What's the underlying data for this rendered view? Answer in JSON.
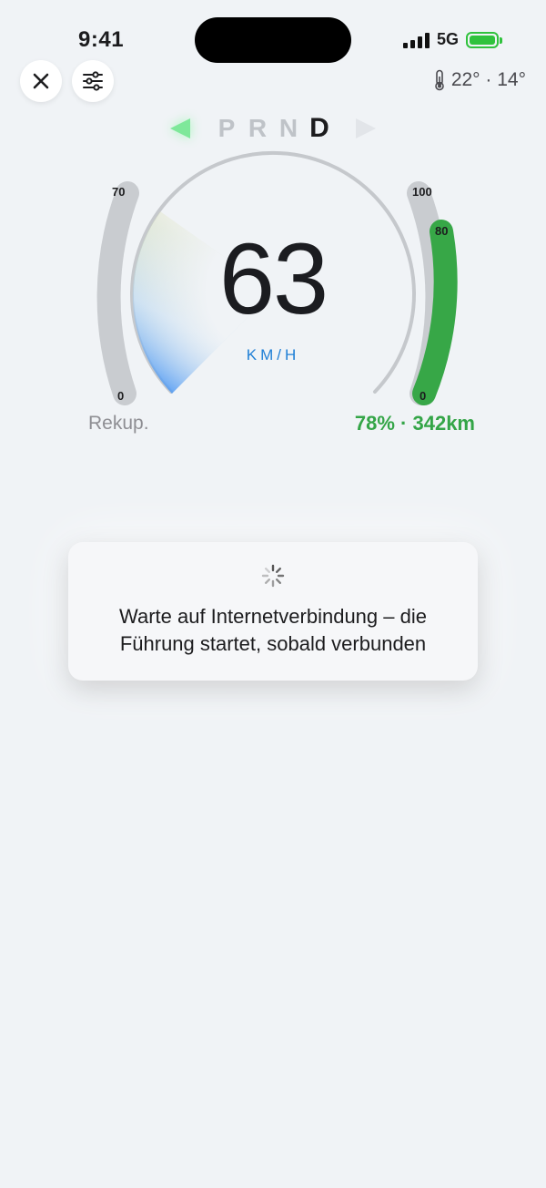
{
  "status": {
    "time": "9:41",
    "network": "5G",
    "battery_level": 1.0
  },
  "controls": {
    "close_icon": "close-icon",
    "settings_icon": "sliders-icon"
  },
  "weather": {
    "text": "22° · 14°",
    "icon": "thermometer-icon"
  },
  "gear_selector": {
    "gears": [
      "P",
      "R",
      "N",
      "D"
    ],
    "active": "D"
  },
  "speedometer": {
    "speed": "63",
    "unit": "KM/H",
    "arc_fill": 0.28
  },
  "regen_gauge": {
    "max_label": "70",
    "min_label": "0",
    "caption": "Rekup.",
    "level": 0.0
  },
  "battery_gauge": {
    "max_label": "100",
    "tick_label": "80",
    "min_label": "0",
    "level": 0.78,
    "caption": "78% · 342km",
    "color": "#34a547"
  },
  "toast": {
    "message": "Warte auf Internetverbindung – die Führung startet, sobald verbunden"
  }
}
